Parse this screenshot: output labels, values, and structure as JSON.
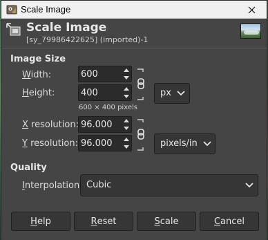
{
  "window": {
    "title": "Scale Image",
    "close_icon": "close-icon"
  },
  "header": {
    "title": "Scale Image",
    "subtitle": "[sy_79986422625] (imported)-1"
  },
  "image_size": {
    "section_label": "Image Size",
    "width_label_mnemonic": "W",
    "width_label_rest": "idth:",
    "width_value": "600",
    "height_label_mnemonic": "H",
    "height_label_rest": "eight:",
    "height_value": "400",
    "size_unit": "px",
    "pixels_info": "600 × 400 pixels",
    "xres_label_mnemonic": "X",
    "xres_label_rest": " resolution:",
    "xres_value": "96.000",
    "yres_label_mnemonic": "Y",
    "yres_label_rest": " resolution:",
    "yres_value": "96.000",
    "res_unit": "pixels/in"
  },
  "quality": {
    "section_label": "Quality",
    "interp_label_mnemonic": "I",
    "interp_label_rest": "nterpolation:",
    "interp_value": "Cubic"
  },
  "buttons": {
    "help_mnemonic": "H",
    "help_rest": "elp",
    "reset_mnemonic": "R",
    "reset_rest": "eset",
    "scale_mnemonic": "S",
    "scale_rest": "cale",
    "cancel_mnemonic": "C",
    "cancel_rest": "ancel"
  }
}
